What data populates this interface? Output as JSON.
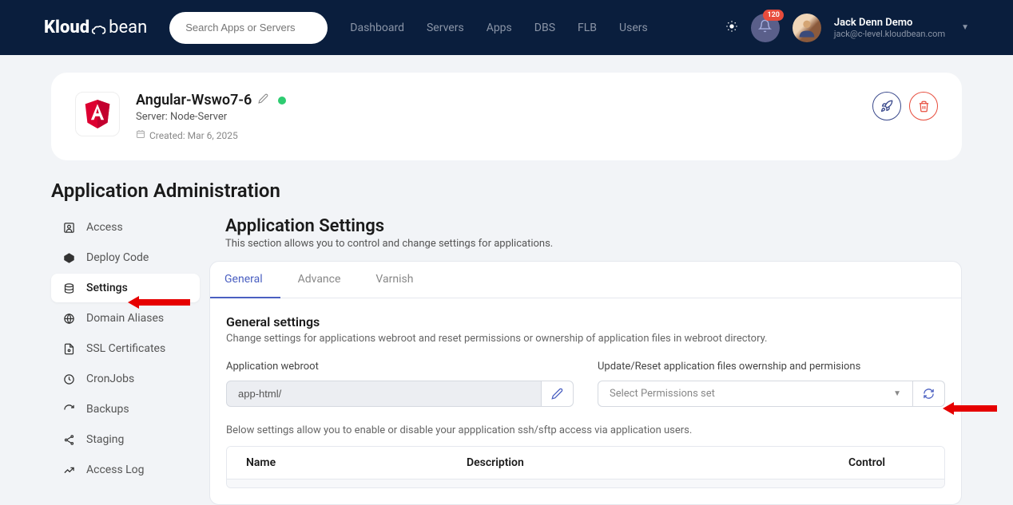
{
  "header": {
    "logo_kloud": "Kloud",
    "logo_bean": "bean",
    "search_placeholder": "Search Apps or Servers",
    "nav": [
      "Dashboard",
      "Servers",
      "Apps",
      "DBS",
      "FLB",
      "Users"
    ],
    "notification_count": "120",
    "user_name": "Jack Denn Demo",
    "user_email": "jack@c-level.kloudbean.com"
  },
  "app": {
    "title": "Angular-Wswo7-6",
    "server_label": "Server: Node-Server",
    "created_label": "Created: Mar 6, 2025"
  },
  "section_title": "Application Administration",
  "sidebar": {
    "items": [
      {
        "label": "Access",
        "icon": "user-square-icon"
      },
      {
        "label": "Deploy Code",
        "icon": "code-icon"
      },
      {
        "label": "Settings",
        "icon": "settings-icon"
      },
      {
        "label": "Domain Aliases",
        "icon": "globe-icon"
      },
      {
        "label": "SSL Certificates",
        "icon": "lock-icon"
      },
      {
        "label": "CronJobs",
        "icon": "clock-icon"
      },
      {
        "label": "Backups",
        "icon": "refresh-ccw-icon"
      },
      {
        "label": "Staging",
        "icon": "share-icon"
      },
      {
        "label": "Access Log",
        "icon": "chart-icon"
      }
    ]
  },
  "content": {
    "title": "Application Settings",
    "description": "This section allows you to control and change settings for applications.",
    "tabs": [
      "General",
      "Advance",
      "Varnish"
    ],
    "general": {
      "title": "General settings",
      "description": "Change settings for applications webroot and reset permissions or ownership of application files in webroot directory.",
      "webroot_label": "Application webroot",
      "webroot_value": "app-html/",
      "permissions_label": "Update/Reset application files owernship and permisions",
      "permissions_placeholder": "Select Permissions set",
      "note": "Below settings allow you to enable or disable your appplication ssh/sftp access via application users.",
      "table_headers": [
        "Name",
        "Description",
        "Control"
      ]
    }
  }
}
